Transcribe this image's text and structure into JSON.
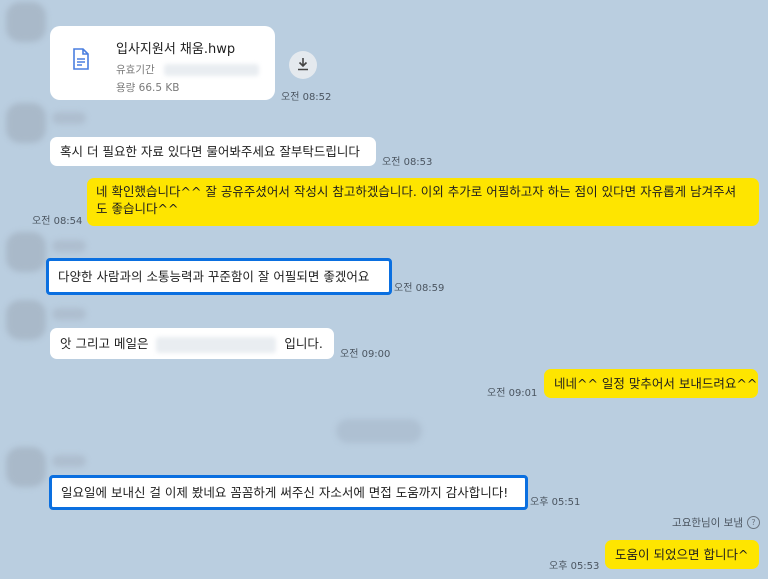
{
  "file_message": {
    "file_name": "입사지원서 채움.hwp",
    "validity_label": "유효기간",
    "size_label": "용량 66.5 KB",
    "time": "오전 08:52",
    "icon": "document-icon",
    "download_icon": "download-icon"
  },
  "messages": [
    {
      "side": "received",
      "text": "혹시 더 필요한 자료 있다면 물어봐주세요 잘부탁드립니다",
      "time": "오전 08:53"
    },
    {
      "side": "sent",
      "line1": "네 확인했습니다^^ 잘 공유주셨어서 작성시 참고하겠습니다. 이외 추가로 어필하고자 하는 점이 있다면 자유롭게 남겨주셔",
      "line2": "도 좋습니다^^",
      "time": "오전 08:54"
    },
    {
      "side": "received",
      "text": "다양한 사람과의 소통능력과 꾸준함이 잘 어필되면 좋겠어요",
      "time": "오전 08:59",
      "highlighted": true
    },
    {
      "side": "received",
      "prefix": "앗 그리고 메일은",
      "suffix": "입니다.",
      "time": "오전 09:00"
    },
    {
      "side": "sent",
      "text": "네네^^ 일정 맞추어서 보내드려요^^",
      "time": "오전 09:01"
    },
    {
      "side": "received",
      "text": "일요일에 보내신 걸 이제 봤네요 꼼꼼하게 써주신 자소서에 면접 도움까지 감사합니다!",
      "time": "오후 05:51",
      "highlighted": true
    },
    {
      "side": "sent",
      "text": "도움이 되었으면 합니다^",
      "time": "오후 05:53"
    }
  ],
  "sender_note": "고요한님이 보냄",
  "colors": {
    "background": "#bacee0",
    "sent_bubble": "#fee500",
    "received_bubble": "#ffffff",
    "highlight": "#0a6fe0"
  }
}
